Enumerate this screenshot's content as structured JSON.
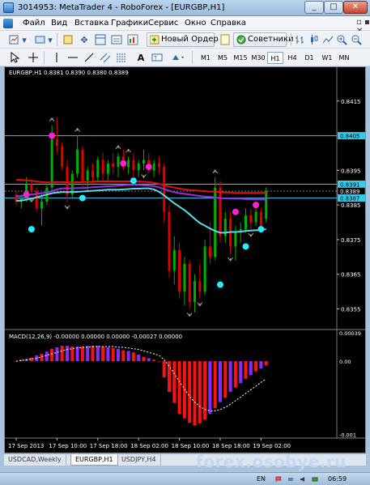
{
  "window": {
    "title": "3014953: MetaTrader 4 - RoboForex - [EURGBP,H1]",
    "min": "_",
    "max": "□",
    "close": "✕"
  },
  "menu": [
    "Файл",
    "Вид",
    "Вставка",
    "Графики",
    "Сервис",
    "Окно",
    "Справка"
  ],
  "toolbar": {
    "new_order": "Новый Ордер",
    "advisors": "Советники"
  },
  "timeframes": [
    "M1",
    "M5",
    "M15",
    "M30",
    "H1",
    "H4",
    "D1",
    "W1",
    "MN"
  ],
  "active_timeframe": "H1",
  "chart": {
    "header": "EURGBP,H1  0.8381 0.8390 0.8380 0.8389",
    "macd_label": "MACD(12,26,9) -0.00000 0.00000 0.00000 -0.00027 0.00000",
    "price_ticks": [
      "0.8415",
      "0.8395",
      "0.8385",
      "0.8375",
      "0.8365",
      "0.8355"
    ],
    "price_badges": [
      {
        "text": "0.8405",
        "type": "level"
      },
      {
        "text": "0.8391",
        "type": "level"
      },
      {
        "text": "0.8389",
        "type": "current"
      },
      {
        "text": "0.8387",
        "type": "level"
      }
    ],
    "macd_ticks": [
      "0.00039",
      "0.00",
      "-0.001"
    ],
    "time_ticks": [
      "17 Sep 2013",
      "17 Sep 10:00",
      "17 Sep 18:00",
      "18 Sep 02:00",
      "18 Sep 10:00",
      "18 Sep 18:00",
      "19 Sep 02:00"
    ],
    "colors": {
      "bull": "#00b000",
      "bear": "#e00000",
      "red_ma": "#e01010",
      "purple_ma": "#9a2ee0",
      "cyan_ma": "#5ad8e8",
      "level": "#38c8e8",
      "dot_magenta": "#ff20d0",
      "dot_cyan": "#20f0ff",
      "macd_red": "#ff1010",
      "macd_purple": "#8a28ff",
      "macd_signal": "#ffffff"
    }
  },
  "chart_data": {
    "type": "candlestick",
    "price_ylim": [
      0.83495,
      0.84215
    ],
    "candles": [
      [
        0.8388,
        0.8389,
        0.8385,
        0.8386
      ],
      [
        0.8386,
        0.8388,
        0.8384,
        0.8387
      ],
      [
        0.8387,
        0.8393,
        0.8386,
        0.8391
      ],
      [
        0.8391,
        0.8392,
        0.8388,
        0.8389
      ],
      [
        0.8389,
        0.839,
        0.8383,
        0.8384
      ],
      [
        0.8384,
        0.8388,
        0.8379,
        0.8386
      ],
      [
        0.8386,
        0.8391,
        0.8385,
        0.839
      ],
      [
        0.839,
        0.8408,
        0.8389,
        0.8404
      ],
      [
        0.8404,
        0.841,
        0.84,
        0.8402
      ],
      [
        0.8402,
        0.8403,
        0.8395,
        0.8396
      ],
      [
        0.8396,
        0.8398,
        0.8386,
        0.8388
      ],
      [
        0.8388,
        0.8395,
        0.8387,
        0.8394
      ],
      [
        0.8394,
        0.8405,
        0.8393,
        0.8401
      ],
      [
        0.8401,
        0.8402,
        0.839,
        0.8392
      ],
      [
        0.8392,
        0.8396,
        0.8389,
        0.8395
      ],
      [
        0.8395,
        0.8397,
        0.8391,
        0.8393
      ],
      [
        0.8393,
        0.8399,
        0.8392,
        0.8398
      ],
      [
        0.8398,
        0.84,
        0.8392,
        0.8394
      ],
      [
        0.8394,
        0.8398,
        0.8392,
        0.8397
      ],
      [
        0.8397,
        0.84,
        0.8394,
        0.8396
      ],
      [
        0.8396,
        0.84,
        0.8393,
        0.8399
      ],
      [
        0.8399,
        0.8401,
        0.8395,
        0.8396
      ],
      [
        0.8396,
        0.8399,
        0.8394,
        0.8398
      ],
      [
        0.8398,
        0.84,
        0.8393,
        0.8395
      ],
      [
        0.8395,
        0.8398,
        0.8393,
        0.8397
      ],
      [
        0.8397,
        0.8401,
        0.8395,
        0.8398
      ],
      [
        0.8398,
        0.84,
        0.8394,
        0.8395
      ],
      [
        0.8395,
        0.8398,
        0.8393,
        0.8397
      ],
      [
        0.8397,
        0.8399,
        0.8394,
        0.8396
      ],
      [
        0.8396,
        0.8397,
        0.838,
        0.8383
      ],
      [
        0.8383,
        0.8385,
        0.8364,
        0.8366
      ],
      [
        0.8366,
        0.8376,
        0.8362,
        0.8372
      ],
      [
        0.8372,
        0.8374,
        0.8358,
        0.836
      ],
      [
        0.836,
        0.837,
        0.8356,
        0.8368
      ],
      [
        0.8368,
        0.8369,
        0.8355,
        0.8357
      ],
      [
        0.8357,
        0.8365,
        0.8354,
        0.8363
      ],
      [
        0.8363,
        0.8368,
        0.8358,
        0.836
      ],
      [
        0.836,
        0.8375,
        0.8359,
        0.8373
      ],
      [
        0.8373,
        0.838,
        0.8368,
        0.837
      ],
      [
        0.837,
        0.8393,
        0.8369,
        0.839
      ],
      [
        0.839,
        0.8392,
        0.8374,
        0.8376
      ],
      [
        0.8376,
        0.8383,
        0.8374,
        0.8381
      ],
      [
        0.8381,
        0.8383,
        0.8371,
        0.8373
      ],
      [
        0.8373,
        0.8379,
        0.8369,
        0.8377
      ],
      [
        0.8377,
        0.838,
        0.8374,
        0.8378
      ],
      [
        0.8378,
        0.8384,
        0.8377,
        0.8382
      ],
      [
        0.8382,
        0.8384,
        0.8378,
        0.838
      ],
      [
        0.838,
        0.8385,
        0.8379,
        0.8383
      ],
      [
        0.8383,
        0.8384,
        0.8378,
        0.8379
      ],
      [
        0.8381,
        0.839,
        0.838,
        0.8389
      ]
    ],
    "red_ma": [
      0.83922,
      0.83922,
      0.83921,
      0.8392,
      0.83918,
      0.83916,
      0.83915,
      0.83915,
      0.83916,
      0.83916,
      0.83915,
      0.83915,
      0.83916,
      0.83916,
      0.83916,
      0.83917,
      0.83918,
      0.83918,
      0.83918,
      0.83918,
      0.83918,
      0.83918,
      0.83918,
      0.83918,
      0.83918,
      0.83917,
      0.83916,
      0.83914,
      0.83911,
      0.83907,
      0.83903,
      0.839,
      0.83897,
      0.83895,
      0.83893,
      0.83892,
      0.83891,
      0.8389,
      0.83889,
      0.83888,
      0.83887,
      0.83886,
      0.83886,
      0.83885,
      0.83885,
      0.83885,
      0.83885,
      0.83885,
      0.83885,
      0.83885
    ],
    "purple_ma": [
      0.83875,
      0.83876,
      0.83878,
      0.8388,
      0.83882,
      0.83884,
      0.83886,
      0.8389,
      0.83895,
      0.83898,
      0.83898,
      0.83898,
      0.83899,
      0.83899,
      0.839,
      0.83901,
      0.83902,
      0.83903,
      0.83904,
      0.83905,
      0.83906,
      0.83907,
      0.83908,
      0.83908,
      0.83908,
      0.83907,
      0.83906,
      0.83904,
      0.83901,
      0.83896,
      0.83891,
      0.83887,
      0.83884,
      0.83882,
      0.8388,
      0.83878,
      0.83876,
      0.83874,
      0.83873,
      0.83872,
      0.8387,
      0.83869,
      0.83868,
      0.83868,
      0.83868,
      0.83867,
      0.83867,
      0.83866,
      0.83866,
      0.83866
    ],
    "cyan_ma": [
      0.83862,
      0.83863,
      0.83865,
      0.83868,
      0.83872,
      0.83876,
      0.8388,
      0.83884,
      0.83886,
      0.83887,
      0.83887,
      0.83887,
      0.83888,
      0.83889,
      0.8389,
      0.83891,
      0.83892,
      0.83893,
      0.83894,
      0.83894,
      0.83894,
      0.83895,
      0.83896,
      0.83897,
      0.83897,
      0.83898,
      0.83898,
      0.83895,
      0.83888,
      0.83878,
      0.83866,
      0.83855,
      0.83845,
      0.83835,
      0.83823,
      0.8381,
      0.83798,
      0.8379,
      0.83782,
      0.83775,
      0.8377,
      0.8377,
      0.83772,
      0.83772,
      0.83773,
      0.83775,
      0.83776,
      0.83777,
      0.83778,
      0.8378
    ],
    "levels": [
      0.8405,
      0.8391,
      0.8387
    ],
    "dots": [
      {
        "i": 2,
        "price": 0.8388,
        "color": "magenta"
      },
      {
        "i": 3,
        "price": 0.8378,
        "color": "cyan"
      },
      {
        "i": 7,
        "price": 0.8405,
        "color": "magenta"
      },
      {
        "i": 13,
        "price": 0.8387,
        "color": "cyan"
      },
      {
        "i": 21,
        "price": 0.8397,
        "color": "magenta"
      },
      {
        "i": 23,
        "price": 0.8392,
        "color": "cyan"
      },
      {
        "i": 26,
        "price": 0.8396,
        "color": "magenta"
      },
      {
        "i": 40,
        "price": 0.8362,
        "color": "cyan"
      },
      {
        "i": 43,
        "price": 0.8383,
        "color": "magenta"
      },
      {
        "i": 45,
        "price": 0.8373,
        "color": "cyan"
      },
      {
        "i": 47,
        "price": 0.8385,
        "color": "magenta"
      },
      {
        "i": 48,
        "price": 0.8378,
        "color": "cyan"
      }
    ],
    "fractals_up": [
      7,
      12,
      20,
      22,
      39
    ],
    "fractals_down": [
      3,
      10,
      25,
      34,
      36,
      42,
      46
    ],
    "macd_ylim": [
      -0.00105,
      0.00041
    ],
    "macd_hist": [
      0.0,
      2e-05,
      3e-05,
      5e-05,
      8e-05,
      0.0001,
      0.00013,
      0.00017,
      0.00019,
      0.00021,
      0.00021,
      0.0002,
      0.0002,
      0.0002,
      0.00021,
      0.00021,
      0.00021,
      0.0002,
      0.00019,
      0.00018,
      0.00017,
      0.00015,
      0.00014,
      0.00012,
      9e-05,
      6e-05,
      4e-05,
      2e-05,
      0.0,
      -0.00022,
      -0.00042,
      -0.00057,
      -0.00072,
      -0.00078,
      -0.00084,
      -0.00088,
      -0.00085,
      -0.0008,
      -0.00072,
      -0.00064,
      -0.00056,
      -0.0005,
      -0.00042,
      -0.00036,
      -0.0003,
      -0.00024,
      -0.00019,
      -0.00014,
      -0.0001,
      -6e-05
    ],
    "macd_signal": [
      0.0,
      1e-05,
      2e-05,
      3e-05,
      4e-05,
      6e-05,
      8e-05,
      0.0001,
      0.00012,
      0.00014,
      0.00016,
      0.00017,
      0.00018,
      0.00019,
      0.00019,
      0.0002,
      0.0002,
      0.0002,
      0.0002,
      0.0002,
      0.00019,
      0.00019,
      0.00018,
      0.00017,
      0.00016,
      0.00014,
      0.00012,
      0.0001,
      8e-05,
      2e-05,
      -7e-05,
      -0.00017,
      -0.00028,
      -0.00038,
      -0.00048,
      -0.00056,
      -0.00062,
      -0.00066,
      -0.00068,
      -0.00068,
      -0.00066,
      -0.00063,
      -0.00059,
      -0.00054,
      -0.00049,
      -0.00044,
      -0.00039,
      -0.00034,
      -0.00029,
      -0.00024
    ],
    "time_tick_indices": [
      0,
      8,
      16,
      24,
      32,
      40,
      48
    ]
  },
  "tabs": [
    {
      "label": "USDCAD,Weekly",
      "active": false
    },
    {
      "label": "EURGBP,H1",
      "active": true
    },
    {
      "label": "USDJPY,H4",
      "active": false
    }
  ],
  "watermark": "forex.osobye.ru",
  "taskbar": {
    "lang": "EN",
    "time": "06:59"
  }
}
